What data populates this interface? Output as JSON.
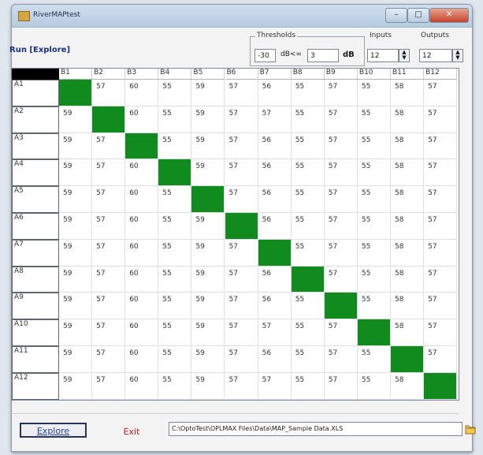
{
  "window": {
    "title": "RiverMAPtest",
    "mode": "Run [Explore]",
    "controls": {
      "minimize": "–",
      "maximize": "□",
      "close": "✕"
    }
  },
  "thresholds": {
    "title": "Thresholds",
    "low_value": "-30",
    "op_label": "dB<=",
    "high_value": "3",
    "unit": "dB"
  },
  "inputs": {
    "title": "Inputs",
    "value": "12"
  },
  "outputs": {
    "title": "Outputs",
    "value": "12"
  },
  "matrix": {
    "col_headers": [
      "B1",
      "B2",
      "B3",
      "B4",
      "B5",
      "B6",
      "B7",
      "B8",
      "B9",
      "B10",
      "B11",
      "B12"
    ],
    "row_headers": [
      "A1",
      "A2",
      "A3",
      "A4",
      "A5",
      "A6",
      "A7",
      "A8",
      "A9",
      "A10",
      "A11",
      "A12"
    ],
    "rows": [
      [
        "",
        "57",
        "60",
        "55",
        "59",
        "57",
        "56",
        "55",
        "57",
        "55",
        "58",
        "57"
      ],
      [
        "59",
        "",
        "60",
        "55",
        "59",
        "57",
        "57",
        "55",
        "57",
        "55",
        "58",
        "57"
      ],
      [
        "59",
        "57",
        "",
        "55",
        "59",
        "57",
        "56",
        "55",
        "57",
        "55",
        "58",
        "57"
      ],
      [
        "59",
        "57",
        "60",
        "",
        "59",
        "57",
        "56",
        "55",
        "57",
        "55",
        "58",
        "57"
      ],
      [
        "59",
        "57",
        "60",
        "55",
        "",
        "57",
        "56",
        "55",
        "57",
        "55",
        "58",
        "57"
      ],
      [
        "59",
        "57",
        "60",
        "55",
        "59",
        "",
        "56",
        "55",
        "57",
        "55",
        "58",
        "57"
      ],
      [
        "59",
        "57",
        "60",
        "55",
        "59",
        "57",
        "",
        "55",
        "57",
        "55",
        "58",
        "57"
      ],
      [
        "59",
        "57",
        "60",
        "55",
        "59",
        "57",
        "56",
        "",
        "57",
        "55",
        "58",
        "57"
      ],
      [
        "59",
        "57",
        "60",
        "55",
        "59",
        "57",
        "56",
        "55",
        "",
        "55",
        "58",
        "57"
      ],
      [
        "59",
        "57",
        "60",
        "55",
        "59",
        "57",
        "57",
        "55",
        "57",
        "",
        "58",
        "57"
      ],
      [
        "59",
        "57",
        "60",
        "55",
        "59",
        "57",
        "56",
        "55",
        "57",
        "55",
        "",
        "57"
      ],
      [
        "59",
        "57",
        "60",
        "55",
        "59",
        "57",
        "57",
        "55",
        "57",
        "55",
        "58",
        ""
      ]
    ],
    "diagonal_color": "#118b1d"
  },
  "footer": {
    "explore_label": "Explore",
    "exit_label": "Exit",
    "file_path": "C:\\OptoTest\\OPLMAX Files\\Data\\MAP_Sample Data.XLS",
    "folder_icon": "folder-icon"
  }
}
